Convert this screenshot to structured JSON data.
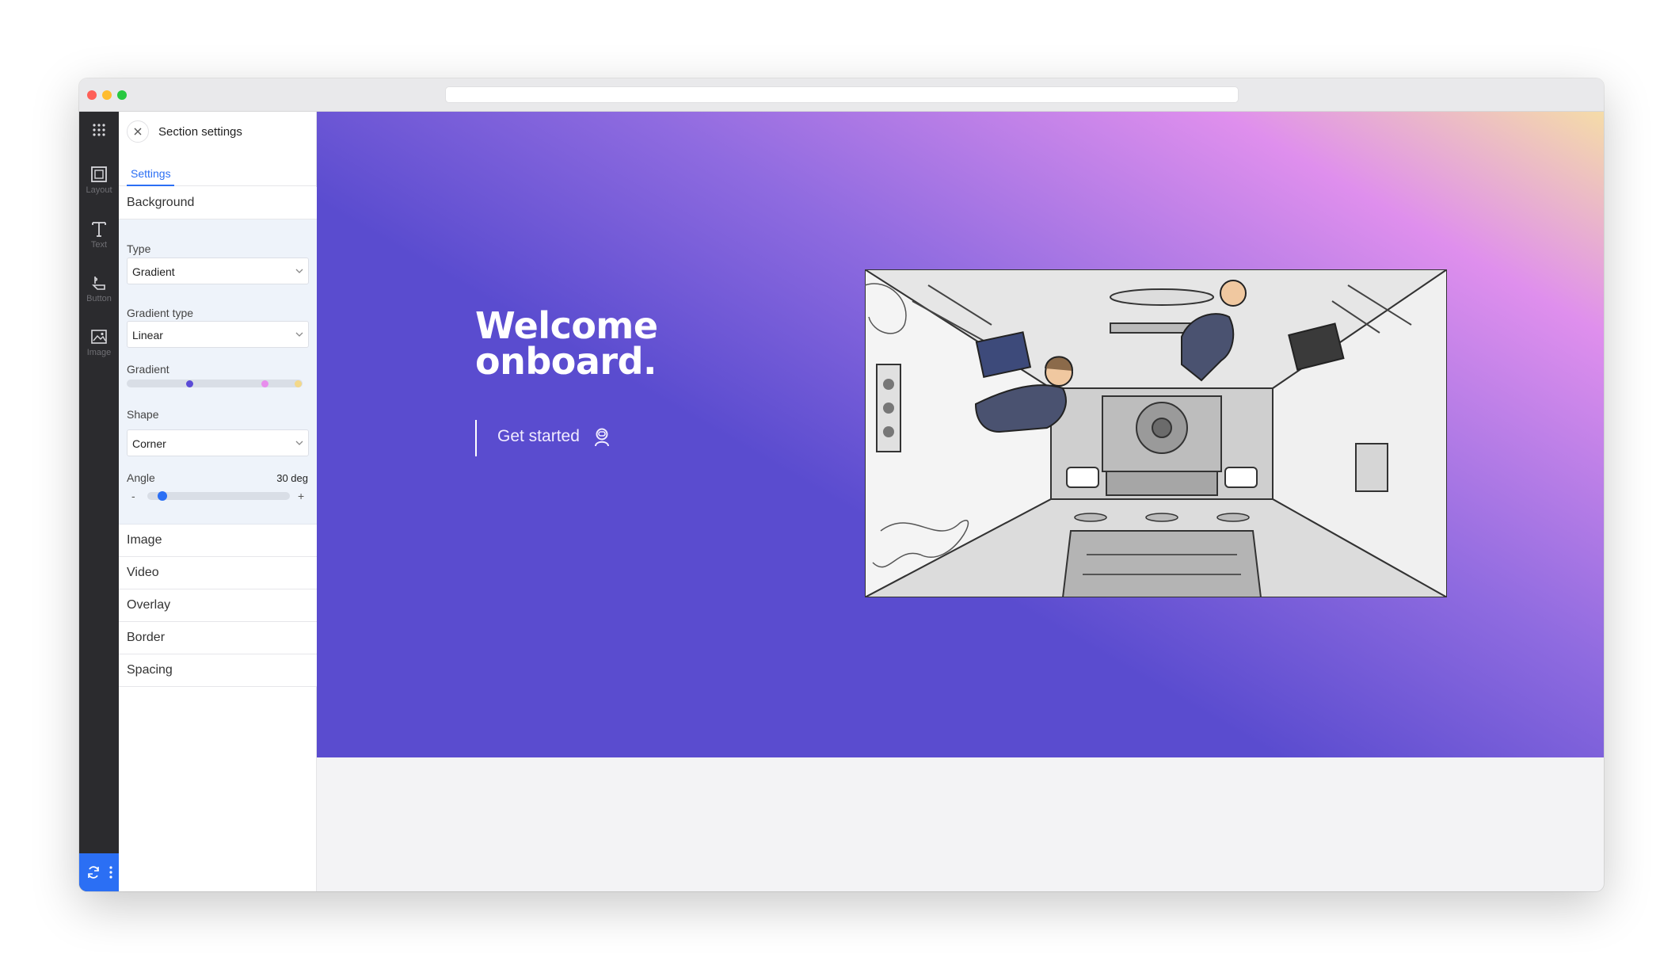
{
  "sidebar_panel": {
    "title": "Section settings",
    "tabs": [
      {
        "label": "Settings"
      }
    ],
    "background_section": {
      "label": "Background",
      "type_label": "Type",
      "type_value": "Gradient",
      "gradient_type_label": "Gradient type",
      "gradient_type_value": "Linear",
      "gradient_label": "Gradient",
      "gradient_stops": [
        "#5b4bd6",
        "#e88ded",
        "#f3d88a"
      ],
      "shape_label": "Shape",
      "shape_value": "Corner",
      "angle_label": "Angle",
      "angle_value": "30 deg",
      "angle_minus": "-",
      "angle_plus": "+"
    },
    "sections": [
      {
        "label": "Image"
      },
      {
        "label": "Video"
      },
      {
        "label": "Overlay"
      },
      {
        "label": "Border"
      },
      {
        "label": "Spacing"
      }
    ]
  },
  "rail": {
    "items": [
      {
        "label": "Layout",
        "icon": "layout-icon"
      },
      {
        "label": "Text",
        "icon": "text-icon"
      },
      {
        "label": "Button",
        "icon": "button-icon"
      },
      {
        "label": "Image",
        "icon": "image-icon"
      }
    ]
  },
  "hero": {
    "headline_line1": "Welcome",
    "headline_line2": "onboard.",
    "cta_label": "Get started",
    "cta_icon": "astronaut-icon",
    "illustration": "space-station-interior-illustration"
  },
  "colors": {
    "accent": "#2b6ff4",
    "rail_bg": "#2b2b2e",
    "gradient_start": "#5a4ccf",
    "gradient_mid": "#df8fed",
    "gradient_end": "#f5dca8"
  }
}
